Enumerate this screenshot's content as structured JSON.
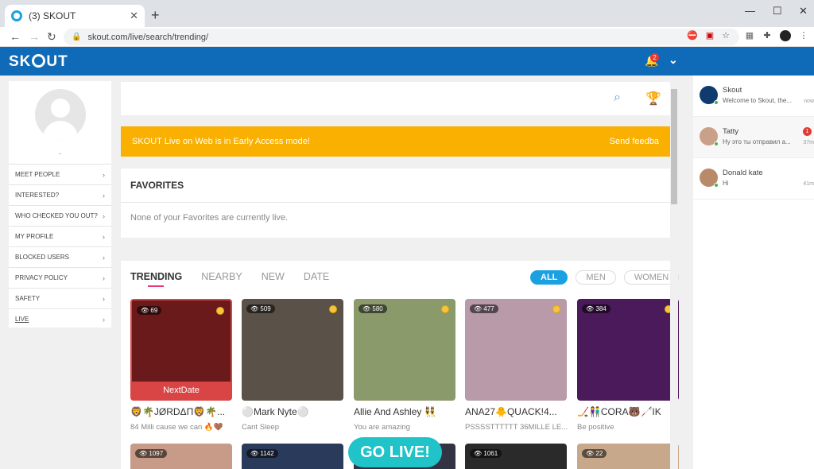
{
  "browser": {
    "tab_title": "(3) SKOUT",
    "url": "skout.com/live/search/trending/"
  },
  "header": {
    "logo": "SK",
    "logo_end": "UT",
    "notifications": "2"
  },
  "profile": {
    "name": "."
  },
  "menu": [
    {
      "label": "MEET PEOPLE"
    },
    {
      "label": "INTERESTED?"
    },
    {
      "label": "WHO CHECKED YOU OUT?"
    },
    {
      "label": "MY PROFILE"
    },
    {
      "label": "BLOCKED USERS"
    },
    {
      "label": "PRIVACY POLICY"
    },
    {
      "label": "SAFETY"
    },
    {
      "label": "LIVE"
    }
  ],
  "banner": {
    "text": "SKOUT Live on Web is in Early Access mode!",
    "link": "Send feedba"
  },
  "favorites": {
    "title": "FAVORITES",
    "empty": "None of your Favorites are currently live."
  },
  "tabs": [
    "TRENDING",
    "NEARBY",
    "NEW",
    "DATE"
  ],
  "filters": [
    "ALL",
    "MEN",
    "WOMEN"
  ],
  "streams": [
    {
      "viewers": "69",
      "name": "🦁🌴JØRDΔΠ🦁🌴...",
      "sub": "84 Milli cause we can 🔥🤎",
      "label": "NextDate",
      "color": "#6a1a1a"
    },
    {
      "viewers": "509",
      "name": "⚪Mark Nyte⚪",
      "sub": "Cant Sleep",
      "color": "#5a5148"
    },
    {
      "viewers": "580",
      "name": "Allie And Ashley 👯",
      "sub": "You are amazing",
      "color": "#8b9a6a"
    },
    {
      "viewers": "477",
      "name": "ANA27🐥QUACK!4...",
      "sub": "PSSSSTTTTTT 36MILLE LE...",
      "color": "#b89aa8"
    },
    {
      "viewers": "384",
      "name": "🏒👫CORA🐻🦯IK",
      "sub": "Be positive",
      "color": "#4a1a5a"
    }
  ],
  "row2": [
    {
      "viewers": "1097"
    },
    {
      "viewers": "1142"
    },
    {
      "viewers": ""
    },
    {
      "viewers": "1061"
    },
    {
      "viewers": "22"
    }
  ],
  "golive": "GO LIVE!",
  "chats": [
    {
      "name": "Skout",
      "msg": "Welcome to Skout, the...",
      "time": "now"
    },
    {
      "name": "Tatty",
      "msg": "Ну это ты отправил а...",
      "time": "37m",
      "unread": "1"
    },
    {
      "name": "Donald kate",
      "msg": "Hi",
      "time": "41m"
    }
  ]
}
